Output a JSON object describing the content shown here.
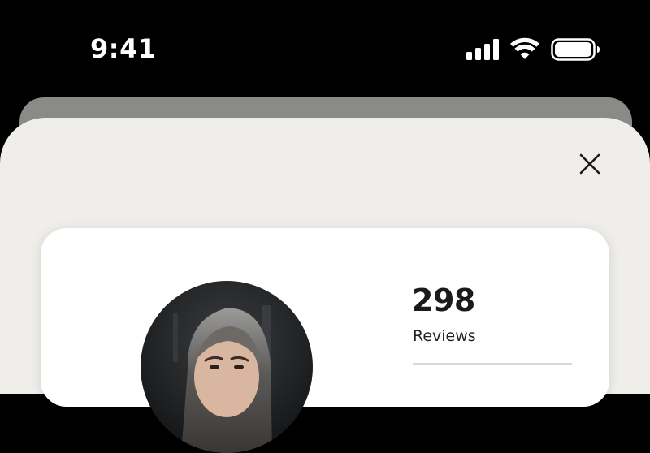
{
  "status_bar": {
    "time": "9:41",
    "icons": [
      "cellular-signal-icon",
      "wifi-icon",
      "battery-icon"
    ]
  },
  "sheet": {
    "close_icon": "close-icon"
  },
  "profile_card": {
    "avatar_alt": "avatar",
    "stats": [
      {
        "value": "298",
        "label": "Reviews"
      }
    ]
  },
  "colors": {
    "status_bar_bg": "#000000",
    "back_sheet": "#8a8a88",
    "sheet_bg": "#efeeeb",
    "card_bg": "#ffffff",
    "text_primary": "#1a1a1a",
    "divider": "#d8d8d6"
  }
}
